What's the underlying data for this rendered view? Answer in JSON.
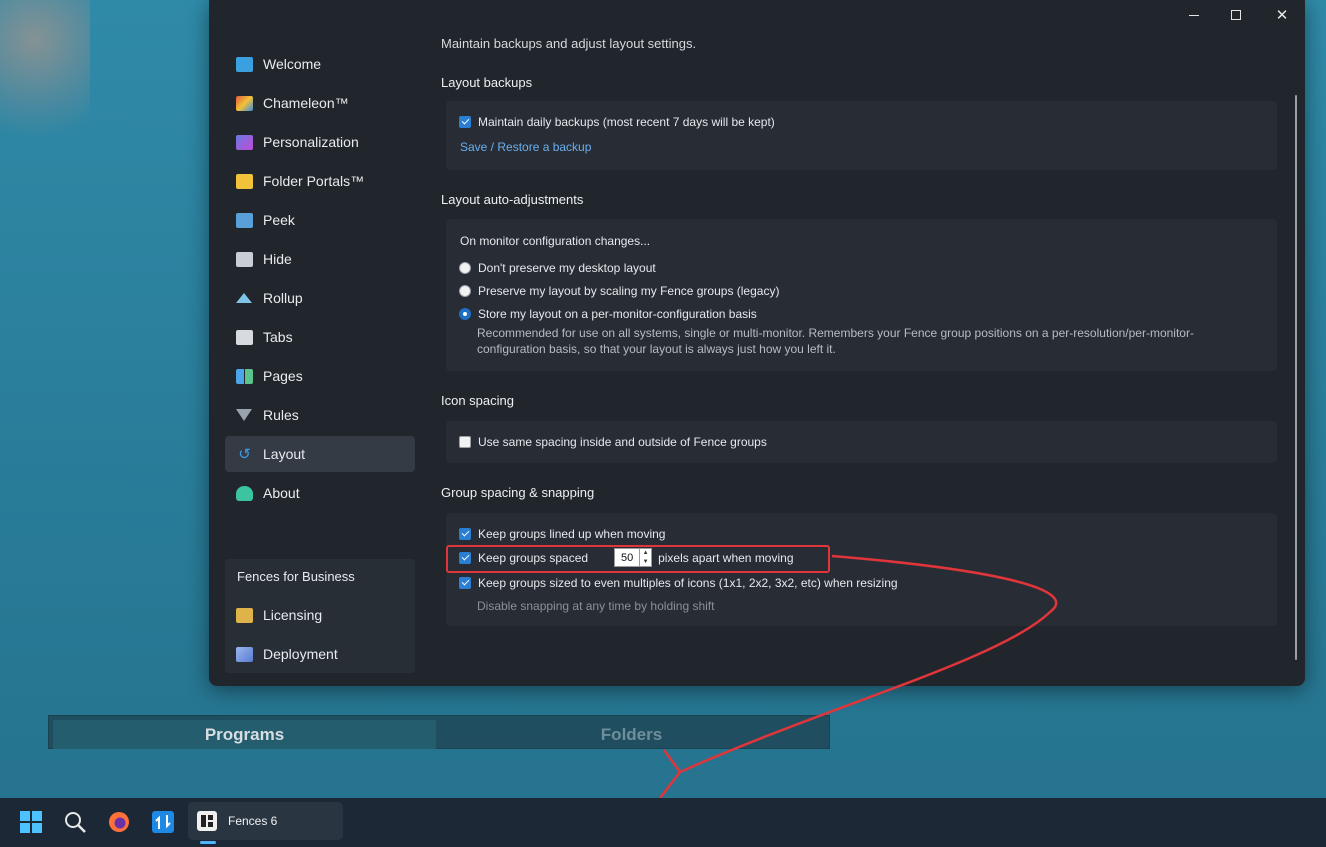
{
  "window": {
    "minimize_icon": "minimize-icon",
    "maximize_icon": "maximize-icon",
    "close_icon": "close-icon"
  },
  "sidebar": {
    "items": [
      {
        "label": "Welcome",
        "icon": "monitor-icon",
        "color": "#3aa0e0"
      },
      {
        "label": "Chameleon™",
        "icon": "chameleon-icon",
        "color": "#e07a3a"
      },
      {
        "label": "Personalization",
        "icon": "personalization-icon",
        "color": "#6a7ae0"
      },
      {
        "label": "Folder Portals™",
        "icon": "folder-icon",
        "color": "#f2c23a"
      },
      {
        "label": "Peek",
        "icon": "peek-icon",
        "color": "#5aa0d8"
      },
      {
        "label": "Hide",
        "icon": "hide-icon",
        "color": "#c9ced4"
      },
      {
        "label": "Rollup",
        "icon": "rollup-icon",
        "color": "#7fc4e8"
      },
      {
        "label": "Tabs",
        "icon": "tabs-icon",
        "color": "#d7dbe0"
      },
      {
        "label": "Pages",
        "icon": "pages-icon",
        "color": "#4aa6e8"
      },
      {
        "label": "Rules",
        "icon": "funnel-icon",
        "color": "#9aa3ad"
      },
      {
        "label": "Layout",
        "icon": "layout-icon",
        "color": "#3c9be8",
        "active": true
      },
      {
        "label": "About",
        "icon": "user-icon",
        "color": "#3cc4a0"
      }
    ],
    "business": {
      "title": "Fences for Business",
      "items": [
        {
          "label": "Licensing",
          "icon": "licensing-icon",
          "color": "#e0b24a"
        },
        {
          "label": "Deployment",
          "icon": "cube-icon",
          "color": "#7aa0e8"
        }
      ]
    }
  },
  "content": {
    "intro": "Maintain backups and adjust layout settings.",
    "backups": {
      "title": "Layout backups",
      "daily_label": "Maintain daily backups (most recent 7 days will be kept)",
      "daily_checked": true,
      "link": "Save / Restore a backup"
    },
    "auto_adjust": {
      "title": "Layout auto-adjustments",
      "prompt": "On monitor configuration changes...",
      "options": [
        {
          "label": "Don't preserve my desktop layout",
          "selected": false
        },
        {
          "label": "Preserve my layout by scaling my Fence groups (legacy)",
          "selected": false
        },
        {
          "label": "Store my layout on a per-monitor-configuration basis",
          "selected": true
        }
      ],
      "desc_line1": "Recommended for use on all systems, single or multi-monitor. Remembers your Fence group positions on a per-resolution/per-monitor-",
      "desc_line2": "configuration basis, so that your layout is always just how you left it."
    },
    "icon_spacing": {
      "title": "Icon spacing",
      "same_label": "Use same spacing inside and outside of Fence groups",
      "same_checked": false
    },
    "group_spacing": {
      "title": "Group spacing & snapping",
      "lined_label": "Keep groups lined up when moving",
      "spaced_label": "Keep groups spaced",
      "spaced_value": "50",
      "spaced_suffix": "pixels apart when moving",
      "sized_label": "Keep groups sized to even multiples of icons (1x1, 2x2, 3x2, etc) when resizing",
      "hint": "Disable snapping at any time by holding shift"
    }
  },
  "fence": {
    "tabs": [
      "Programs",
      "Folders"
    ]
  },
  "taskbar": {
    "icons": [
      "windows-start-icon",
      "search-icon",
      "firefox-icon",
      "app-icon"
    ],
    "app_label": "Fences 6",
    "app_icon": "fences-icon"
  },
  "annotation": {
    "color": "#e0353a"
  }
}
